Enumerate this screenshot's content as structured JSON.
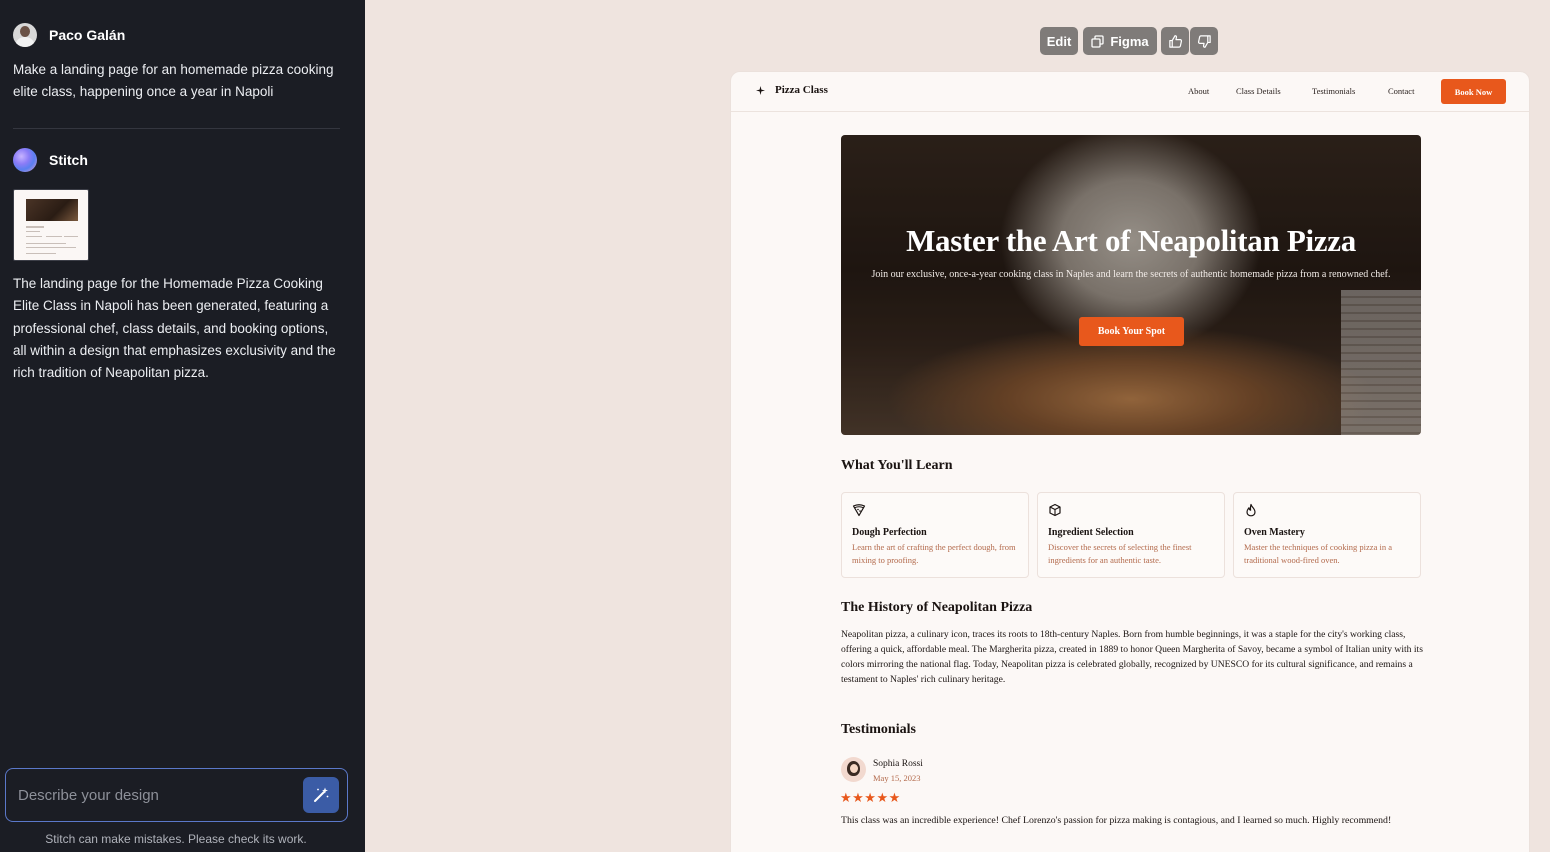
{
  "chat": {
    "user": {
      "name": "Paco Galán",
      "prompt": "Make a landing page for an homemade pizza cooking elite class, happening once a year in Napoli"
    },
    "assistant": {
      "name": "Stitch",
      "response": "The landing page for the Homemade Pizza Cooking Elite Class in Napoli has been generated, featuring a professional chef, class details, and booking options, all within a design that emphasizes exclusivity and the rich tradition of Neapolitan pizza."
    },
    "composer": {
      "placeholder": "Describe your design",
      "send_icon": "magic-wand-icon"
    },
    "disclaimer": "Stitch can make mistakes. Please check its work."
  },
  "toolbar": {
    "edit_label": "Edit",
    "figma_label": "Figma",
    "thumbs_up_icon": "thumbs-up-icon",
    "thumbs_down_icon": "thumbs-down-icon"
  },
  "preview": {
    "brand": "Pizza Class",
    "nav_links": [
      "About",
      "Class Details",
      "Testimonials",
      "Contact"
    ],
    "book_now": "Book Now",
    "hero": {
      "title": "Master the Art of Neapolitan Pizza",
      "subtitle": "Join our exclusive, once-a-year cooking class in Naples and learn the secrets of authentic homemade pizza from a renowned chef.",
      "cta": "Book Your Spot"
    },
    "learn": {
      "heading": "What You'll Learn",
      "cards": [
        {
          "icon": "pizza-slice-icon",
          "title": "Dough Perfection",
          "desc": "Learn the art of crafting the perfect dough, from mixing to proofing."
        },
        {
          "icon": "cube-icon",
          "title": "Ingredient Selection",
          "desc": "Discover the secrets of selecting the finest ingredients for an authentic taste."
        },
        {
          "icon": "flame-icon",
          "title": "Oven Mastery",
          "desc": "Master the techniques of cooking pizza in a traditional wood-fired oven."
        }
      ]
    },
    "history": {
      "heading": "The History of Neapolitan Pizza",
      "text": "Neapolitan pizza, a culinary icon, traces its roots to 18th-century Naples. Born from humble beginnings, it was a staple for the city's working class, offering a quick, affordable meal. The Margherita pizza, created in 1889 to honor Queen Margherita of Savoy, became a symbol of Italian unity with its colors mirroring the national flag. Today, Neapolitan pizza is celebrated globally, recognized by UNESCO for its cultural significance, and remains a testament to Naples' rich culinary heritage."
    },
    "testimonials": {
      "heading": "Testimonials",
      "items": [
        {
          "name": "Sophia Rossi",
          "date": "May 15, 2023",
          "rating": 5,
          "stars": "★★★★★",
          "text": "This class was an incredible experience! Chef Lorenzo's passion for pizza making is contagious, and I learned so much. Highly recommend!"
        }
      ]
    }
  },
  "colors": {
    "accent": "#e8581c",
    "sidebar_bg": "#1b1d24",
    "canvas_bg": "#efe4df",
    "muted_text": "#b36a4c"
  }
}
